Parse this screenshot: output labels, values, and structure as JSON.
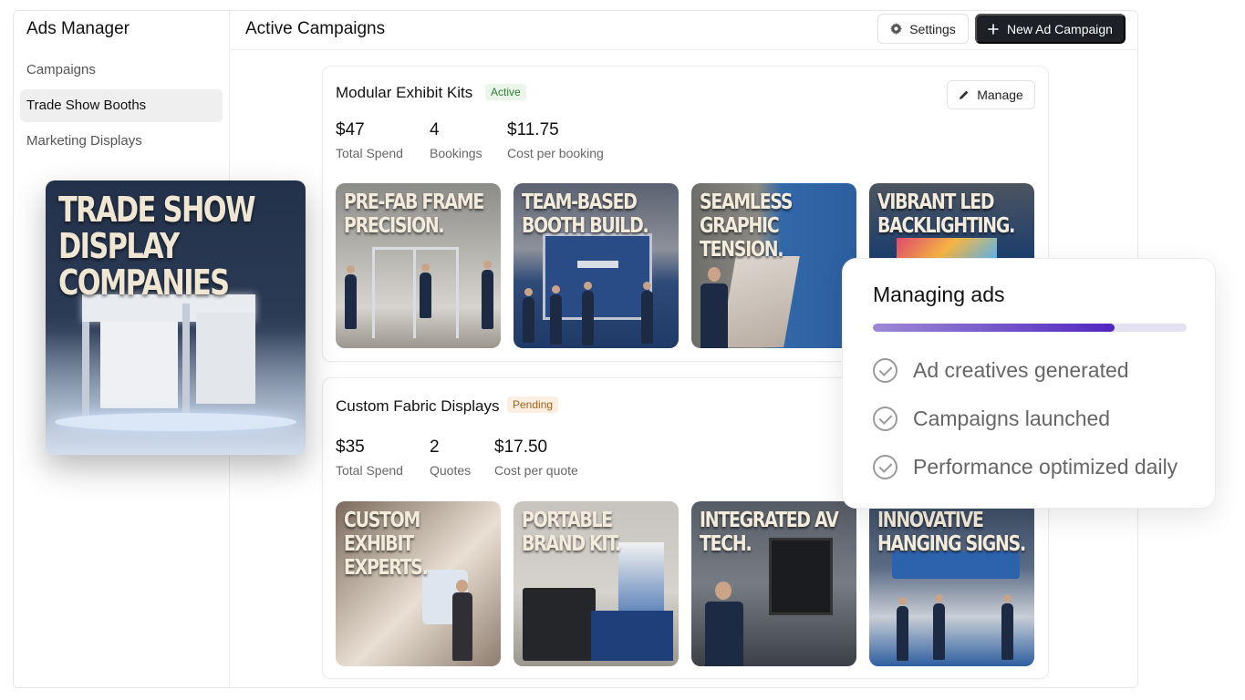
{
  "sidebar": {
    "app_title": "Ads Manager",
    "items": [
      {
        "label": "Campaigns"
      },
      {
        "label": "Trade Show Booths"
      },
      {
        "label": "Marketing Displays"
      }
    ]
  },
  "header": {
    "title": "Active Campaigns",
    "settings_label": "Settings",
    "new_campaign_label": "New Ad Campaign"
  },
  "hero": {
    "caption": "TRADE SHOW DISPLAY COMPANIES"
  },
  "campaigns": [
    {
      "name": "Modular Exhibit Kits",
      "status": "Active",
      "manage_label": "Manage",
      "metrics": [
        {
          "value": "$47",
          "label": "Total Spend"
        },
        {
          "value": "4",
          "label": "Bookings"
        },
        {
          "value": "$11.75",
          "label": "Cost per booking"
        }
      ],
      "creatives": [
        {
          "caption": "PRE-FAB FRAME PRECISION."
        },
        {
          "caption": "TEAM-BASED BOOTH BUILD."
        },
        {
          "caption": "SEAMLESS GRAPHIC TENSION."
        },
        {
          "caption": "VIBRANT LED BACKLIGHTING."
        }
      ]
    },
    {
      "name": "Custom Fabric Displays",
      "status": "Pending",
      "metrics": [
        {
          "value": "$35",
          "label": "Total Spend"
        },
        {
          "value": "2",
          "label": "Quotes"
        },
        {
          "value": "$17.50",
          "label": "Cost per quote"
        }
      ],
      "creatives": [
        {
          "caption": "CUSTOM EXHIBIT EXPERTS."
        },
        {
          "caption": "PORTABLE BRAND KIT."
        },
        {
          "caption": "INTEGRATED AV TECH."
        },
        {
          "caption": "INNOVATIVE HANGING SIGNS."
        }
      ]
    }
  ],
  "progress_panel": {
    "title": "Managing ads",
    "progress": 0.77,
    "steps": [
      {
        "label": "Ad creatives generated"
      },
      {
        "label": "Campaigns launched"
      },
      {
        "label": "Performance optimized daily"
      }
    ]
  },
  "colors": {
    "primary_button": "#1d2027",
    "active_badge_bg": "#eaf6ea",
    "active_badge_text": "#2f7d32",
    "pending_badge_bg": "#fbefe1",
    "pending_badge_text": "#a5621a",
    "progress_start": "#9d8ad6",
    "progress_end": "#5126c0"
  },
  "icons": {
    "settings": "gear-icon",
    "new_campaign": "plus-icon",
    "manage": "pencil-icon",
    "step": "check-circle-icon"
  }
}
